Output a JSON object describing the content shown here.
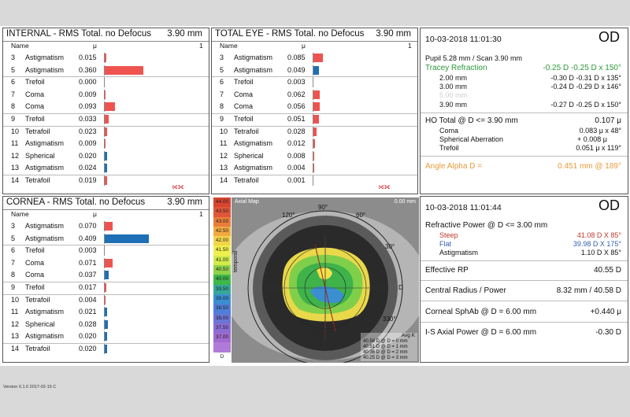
{
  "internal": {
    "title": "INTERNAL   - RMS Total. no Defocus",
    "value": "3.90 mm",
    "col_name": "Name",
    "col_unit": "μ",
    "col_one": "1",
    "rows": [
      {
        "n": "3",
        "name": "Astigmatism",
        "val": "0.015",
        "v": 0.015,
        "color": "#ef5350"
      },
      {
        "n": "5",
        "name": "Astigmatism",
        "val": "0.360",
        "v": 0.36,
        "color": "#ef5350"
      },
      {
        "n": "6",
        "name": "Trefoil",
        "val": "0.000",
        "v": 0.0,
        "color": "#ef5350"
      },
      {
        "n": "7",
        "name": "Coma",
        "val": "0.009",
        "v": 0.009,
        "color": "#ef5350"
      },
      {
        "n": "8",
        "name": "Coma",
        "val": "0.093",
        "v": 0.093,
        "color": "#ef5350"
      },
      {
        "n": "9",
        "name": "Trefoil",
        "val": "0.033",
        "v": 0.033,
        "color": "#ef5350"
      },
      {
        "n": "10",
        "name": "Tetrafoil",
        "val": "0.023",
        "v": 0.023,
        "color": "#ef5350"
      },
      {
        "n": "11",
        "name": "Astigmatism",
        "val": "0.009",
        "v": 0.009,
        "color": "#ef5350"
      },
      {
        "n": "12",
        "name": "Spherical",
        "val": "0.020",
        "v": 0.02,
        "color": "#1e6fb5"
      },
      {
        "n": "13",
        "name": "Astigmatism",
        "val": "0.024",
        "v": 0.024,
        "color": "#1e6fb5"
      },
      {
        "n": "14",
        "name": "Tetrafoil",
        "val": "0.019",
        "v": 0.019,
        "color": "#ef5350"
      }
    ]
  },
  "total_eye": {
    "title": "TOTAL EYE   - RMS Total. no Defocus",
    "value": "3.90 mm",
    "col_name": "Name",
    "col_unit": "μ",
    "col_one": "1",
    "rows": [
      {
        "n": "3",
        "name": "Astigmatism",
        "val": "0.085",
        "v": 0.085,
        "color": "#ef5350"
      },
      {
        "n": "5",
        "name": "Astigmatism",
        "val": "0.049",
        "v": 0.049,
        "color": "#1e6fb5"
      },
      {
        "n": "6",
        "name": "Trefoil",
        "val": "0.003",
        "v": 0.003,
        "color": "#ef5350"
      },
      {
        "n": "7",
        "name": "Coma",
        "val": "0.062",
        "v": 0.062,
        "color": "#ef5350"
      },
      {
        "n": "8",
        "name": "Coma",
        "val": "0.056",
        "v": 0.056,
        "color": "#ef5350"
      },
      {
        "n": "9",
        "name": "Trefoil",
        "val": "0.051",
        "v": 0.051,
        "color": "#ef5350"
      },
      {
        "n": "10",
        "name": "Tetrafoil",
        "val": "0.028",
        "v": 0.028,
        "color": "#ef5350"
      },
      {
        "n": "11",
        "name": "Astigmatism",
        "val": "0.012",
        "v": 0.012,
        "color": "#ef5350"
      },
      {
        "n": "12",
        "name": "Spherical",
        "val": "0.008",
        "v": 0.008,
        "color": "#ef5350"
      },
      {
        "n": "13",
        "name": "Astigmatism",
        "val": "0.004",
        "v": 0.004,
        "color": "#ef5350"
      },
      {
        "n": "14",
        "name": "Tetrafoil",
        "val": "0.001",
        "v": 0.001,
        "color": "#ef5350"
      }
    ]
  },
  "cornea": {
    "title": "CORNEA   - RMS Total. no Defocus",
    "value": "3.90 mm",
    "col_name": "Name",
    "col_unit": "μ",
    "col_one": "1",
    "rows": [
      {
        "n": "3",
        "name": "Astigmatism",
        "val": "0.070",
        "v": 0.07,
        "color": "#ef5350"
      },
      {
        "n": "5",
        "name": "Astigmatism",
        "val": "0.409",
        "v": 0.409,
        "color": "#1e6fb5"
      },
      {
        "n": "6",
        "name": "Trefoil",
        "val": "0.003",
        "v": 0.003,
        "color": "#ef5350"
      },
      {
        "n": "7",
        "name": "Coma",
        "val": "0.071",
        "v": 0.071,
        "color": "#ef5350"
      },
      {
        "n": "8",
        "name": "Coma",
        "val": "0.037",
        "v": 0.037,
        "color": "#1e6fb5"
      },
      {
        "n": "9",
        "name": "Trefoil",
        "val": "0.017",
        "v": 0.017,
        "color": "#ef5350"
      },
      {
        "n": "10",
        "name": "Tetrafoil",
        "val": "0.004",
        "v": 0.004,
        "color": "#ef5350"
      },
      {
        "n": "11",
        "name": "Astigmatism",
        "val": "0.021",
        "v": 0.021,
        "color": "#1e6fb5"
      },
      {
        "n": "12",
        "name": "Spherical",
        "val": "0.028",
        "v": 0.028,
        "color": "#1e6fb5"
      },
      {
        "n": "13",
        "name": "Astigmatism",
        "val": "0.020",
        "v": 0.02,
        "color": "#1e6fb5"
      },
      {
        "n": "14",
        "name": "Tetrafoil",
        "val": "0.020",
        "v": 0.02,
        "color": "#1e6fb5"
      }
    ]
  },
  "summary_top": {
    "datetime": "10-03-2018  11:01:30",
    "eye": "OD",
    "pupil": "Pupil 5.28 mm  /  Scan 3.90 mm",
    "tracey_label": "Tracey Refraction",
    "tracey_value": "-0.25 D -0.25 D x 150°",
    "refr_rows": [
      {
        "label": "2.00 mm",
        "value": "-0.30 D -0.31 D x 135°"
      },
      {
        "label": "3.00 mm",
        "value": "-0.24 D -0.29 D x 146°"
      },
      {
        "label": "5.00 mm",
        "value": ""
      },
      {
        "label": "3.90 mm",
        "value": "-0.27 D -0.25 D x 150°"
      }
    ],
    "ho_label": "HO Total @ D <= 3.90 mm",
    "ho_value": "0.107 μ",
    "ho_rows": [
      {
        "label": "Coma",
        "value": "0.083 μ x  48°"
      },
      {
        "label": "Spherical Aberration",
        "value": "+ 0.008 μ"
      },
      {
        "label": "Trefoil",
        "value": "0.051 μ x 119°"
      }
    ],
    "angle_label": "Angle Alpha  D =",
    "angle_value": "0.451 mm @ 189°"
  },
  "summary_bottom": {
    "datetime": "10-03-2018  11:01:44",
    "eye": "OD",
    "rp_label": "Refractive Power @ D <= 3.00 mm",
    "steep_label": "Steep",
    "steep_value": "41.08 D X  85°",
    "flat_label": "Flat",
    "flat_value": "39.98 D X 175°",
    "astig_label": "Astigmatism",
    "astig_value": "1.10 D X  85°",
    "erp_label": "Effective RP",
    "erp_value": "40.55 D",
    "cr_label": "Central Radius / Power",
    "cr_value": "8.32 mm / 40.58 D",
    "sphab_label": "Corneal SphAb @ D = 6.00 mm",
    "sphab_value": "+0.440 μ",
    "is_label": "I-S Axial Power @ D = 6.00 mm",
    "is_value": "-0.30 D"
  },
  "map": {
    "title": "Axial Map",
    "top_right": "0.00 mm",
    "angle_top": "90°",
    "angle_120": "120°",
    "angle_60": "60°",
    "angle_30": "30°",
    "angle_330": "330°",
    "label_temporal": "temporal",
    "label_right": "D",
    "avg_k": "Avg K",
    "avg_rows": [
      "40.58 D @ D = 0 mm",
      "40.51 D @ D = 1 mm",
      "40.36 D @ D = 2 mm",
      "40.25 D @ D = 3 mm"
    ],
    "scale_unit": "D",
    "scale": [
      {
        "label": "44.00",
        "color": "#d9442f"
      },
      {
        "label": "43.50",
        "color": "#e0563a"
      },
      {
        "label": "43.00",
        "color": "#ea7d3a"
      },
      {
        "label": "42.50",
        "color": "#f2a93f"
      },
      {
        "label": "42.00",
        "color": "#f4d54a"
      },
      {
        "label": "41.50",
        "color": "#f0ef4c"
      },
      {
        "label": "41.00",
        "color": "#d2ea4a"
      },
      {
        "label": "40.50",
        "color": "#8fd34a"
      },
      {
        "label": "40.00",
        "color": "#3fb84a"
      },
      {
        "label": "39.50",
        "color": "#36a89a"
      },
      {
        "label": "39.00",
        "color": "#3b8fd0"
      },
      {
        "label": "38.50",
        "color": "#4e7fd8"
      },
      {
        "label": "38.00",
        "color": "#6b75d6"
      },
      {
        "label": "37.50",
        "color": "#8b6dd4"
      },
      {
        "label": "37.00",
        "color": "#a06ad0"
      },
      {
        "label": "",
        "color": "#b07bd8"
      }
    ]
  },
  "version": "Version 0.1.0 2017-02-15 C"
}
